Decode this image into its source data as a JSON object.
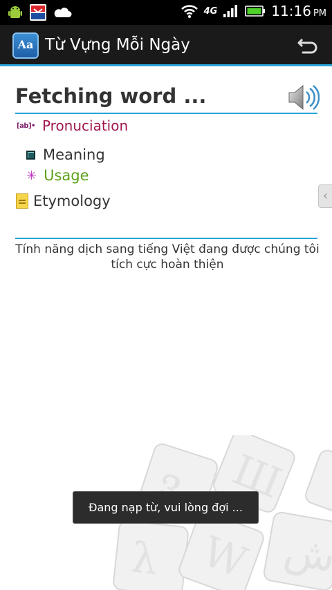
{
  "status_bar": {
    "network": "4G",
    "time": "11:16",
    "ampm": "PM",
    "icons": [
      "android-icon",
      "transit-app-icon",
      "cloud-icon",
      "wifi-icon",
      "signal-icon",
      "battery-icon"
    ]
  },
  "action_bar": {
    "app_icon_text": "Aa",
    "title": "Từ Vựng Mỗi Ngày",
    "back_icon": "back-icon"
  },
  "word": {
    "title": "Fetching word ...",
    "speaker_icon": "speaker-icon"
  },
  "sections": {
    "pronunciation": {
      "icon": "[ab]•",
      "label": "Pronuciation"
    },
    "meaning": {
      "label": "Meaning"
    },
    "usage": {
      "icon": "✳",
      "label": "Usage"
    },
    "etymology": {
      "label": "Etymology"
    }
  },
  "side_tab_glyph": "‹",
  "notice": "Tính năng dịch sang tiếng Việt đang được chúng tôi tích cực hoàn thiện",
  "toast": "Đang nạp từ, vui lòng đợi ...",
  "colors": {
    "accent": "#2aa6d8",
    "pronunciation": "#a0174f",
    "usage": "#5ca11a",
    "action_bar": "#1a1a1a"
  }
}
